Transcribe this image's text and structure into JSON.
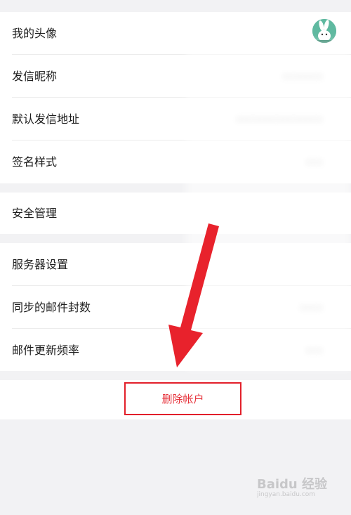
{
  "settings": {
    "avatar_label": "我的头像",
    "nickname_label": "发信昵称",
    "nickname_value": "xxxxxxx",
    "default_address_label": "默认发信地址",
    "default_address_value": "xxxxxxxxxxxxxxx",
    "signature_label": "签名样式",
    "signature_value": "xxx",
    "security_label": "安全管理",
    "server_label": "服务器设置",
    "sync_count_label": "同步的邮件封数",
    "sync_count_value": "xxxx",
    "update_freq_label": "邮件更新频率",
    "update_freq_value": "xxx"
  },
  "actions": {
    "delete_account": "删除帐户"
  },
  "colors": {
    "accent_red": "#e21f2a",
    "avatar_bg": "#5fb9a0"
  },
  "watermark": {
    "logo_text": "Baidu 经验",
    "url_text": "jingyan.baidu.com"
  }
}
